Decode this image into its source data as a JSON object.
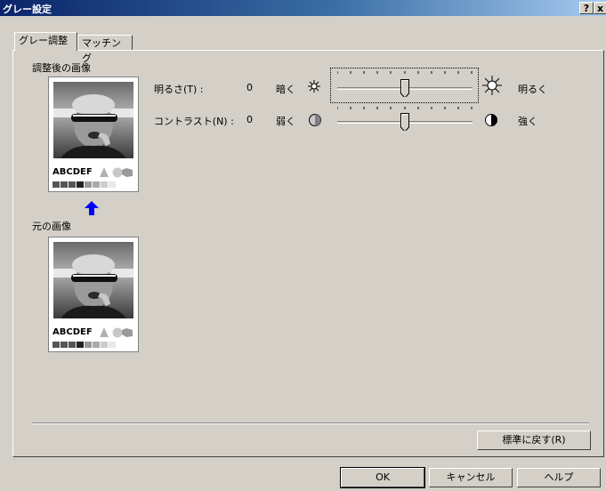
{
  "window": {
    "title": "グレー設定",
    "help_btn": "?",
    "close_btn": "x"
  },
  "tabs": [
    {
      "label": "グレー調整"
    },
    {
      "label": "マッチング"
    }
  ],
  "preview": {
    "adjusted_label": "調整後の画像",
    "original_label": "元の画像",
    "sample_text": "ABCDEF"
  },
  "brightness": {
    "label": "明るさ(T) :",
    "value": "0",
    "low_label": "暗く",
    "high_label": "明るく",
    "level": 0
  },
  "contrast": {
    "label": "コントラスト(N) :",
    "value": "0",
    "low_label": "弱く",
    "high_label": "強く",
    "level": 0
  },
  "buttons": {
    "reset": "標準に戻す(R)",
    "ok": "OK",
    "cancel": "キャンセル",
    "help": "ヘルプ"
  },
  "colors": {
    "title_start": "#0a246a",
    "arrow": "#0000ff",
    "face": "#d4d0c8"
  },
  "icons": {
    "brightness_low": "sun-small-icon",
    "brightness_high": "sun-large-icon",
    "contrast_low": "half-circle-icon",
    "contrast_high": "contrast-icon",
    "arrow": "up-arrow-icon"
  }
}
